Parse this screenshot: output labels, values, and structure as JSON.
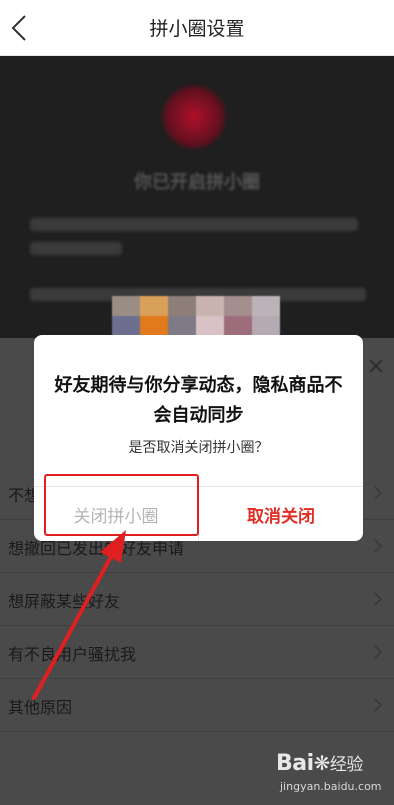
{
  "navbar": {
    "title": "拼小圈设置"
  },
  "top": {
    "title": "你已开启拼小圈"
  },
  "reasons": [
    {
      "label": "不想…"
    },
    {
      "label": "想撤回已发出的好友申请"
    },
    {
      "label": "想屏蔽某些好友"
    },
    {
      "label": "有不良用户骚扰我"
    },
    {
      "label": "其他原因"
    }
  ],
  "dialog": {
    "title": "好友期待与你分享动态，隐私商品不会自动同步",
    "subtitle": "是否取消关闭拼小圈？",
    "close_button": "关闭拼小圈",
    "cancel_button": "取消关闭"
  },
  "watermark": {
    "logo": "Bai",
    "logo_suffix": "经验",
    "url": "jingyan.baidu.com"
  },
  "colors": {
    "accent": "#e02e24",
    "annotation": "#e02020"
  }
}
